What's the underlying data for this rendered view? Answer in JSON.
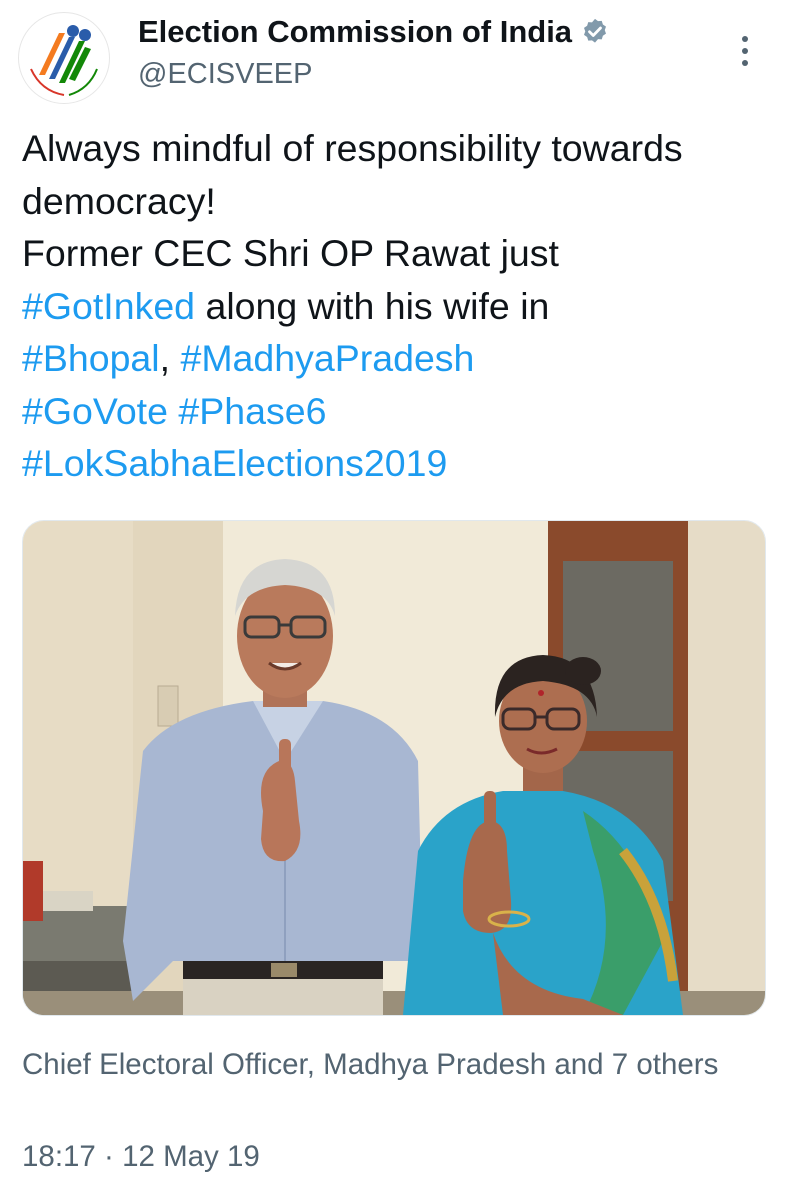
{
  "author": {
    "display_name": "Election Commission of India",
    "handle": "@ECISVEEP",
    "verified": true,
    "avatar_icon": "eci-logo-icon"
  },
  "tweet": {
    "lines": [
      [
        {
          "text": "Always mindful of responsibility towards",
          "hashtag": false
        }
      ],
      [
        {
          "text": "democracy!",
          "hashtag": false
        }
      ],
      [
        {
          "text": "Former CEC Shri OP Rawat just",
          "hashtag": false
        }
      ],
      [
        {
          "text": "#GotInked",
          "hashtag": true
        },
        {
          "text": " along with his wife in",
          "hashtag": false
        }
      ],
      [
        {
          "text": "#Bhopal",
          "hashtag": true
        },
        {
          "text": ", ",
          "hashtag": false
        },
        {
          "text": "#MadhyaPradesh",
          "hashtag": true
        }
      ],
      [
        {
          "text": "#GoVote",
          "hashtag": true
        },
        {
          "text": " ",
          "hashtag": false
        },
        {
          "text": "#Phase6",
          "hashtag": true
        }
      ],
      [
        {
          "text": "#LokSabhaElections2019",
          "hashtag": true
        }
      ]
    ],
    "tagged": "Chief Electoral Officer, Madhya Pradesh and 7 others",
    "time": "18:17",
    "separator": "·",
    "date": "12 May 19"
  },
  "colors": {
    "hashtag": "#1d9bf0",
    "secondary_text": "#536471",
    "verified_badge": "#829aab"
  },
  "icons": {
    "verified": "verified-badge-icon",
    "more": "more-options-icon"
  }
}
